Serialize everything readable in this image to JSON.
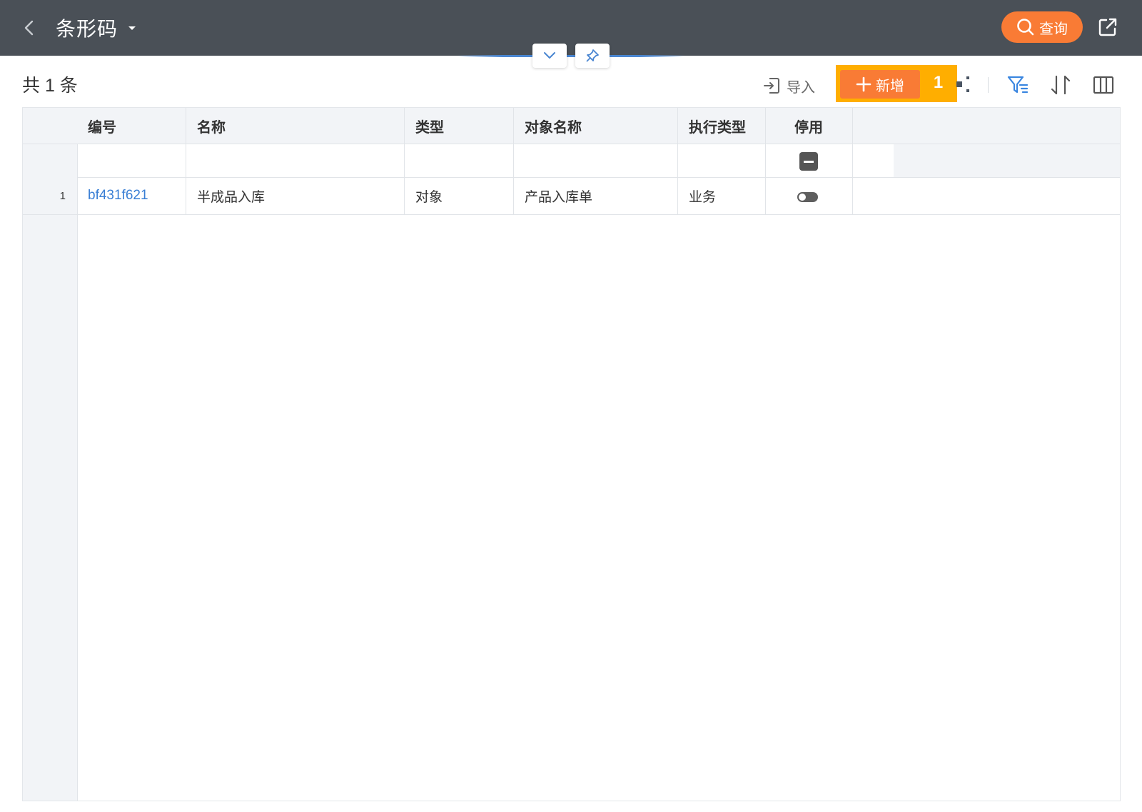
{
  "header": {
    "title": "条形码",
    "query_label": "查询"
  },
  "toolbar": {
    "count_label": "共 1 条",
    "import_label": "导入",
    "add_label": "新增",
    "badge": "1"
  },
  "table": {
    "columns": [
      "编号",
      "名称",
      "类型",
      "对象名称",
      "执行类型",
      "停用"
    ],
    "rows": [
      {
        "index": "1",
        "code": "bf431f621",
        "name": "半成品入库",
        "type": "对象",
        "object_name": "产品入库单",
        "exec_type": "业务",
        "disabled": false
      }
    ]
  },
  "colors": {
    "header_bg": "#4a5057",
    "accent": "#f97b35",
    "highlight": "#ffae00",
    "link": "#3a7fd5"
  },
  "icons": [
    "back-icon",
    "caret-down-icon",
    "search-icon",
    "share-icon",
    "chevron-down-icon",
    "pin-icon",
    "import-icon",
    "plus-icon",
    "more-icon",
    "filter-icon",
    "sort-icon",
    "columns-icon"
  ]
}
